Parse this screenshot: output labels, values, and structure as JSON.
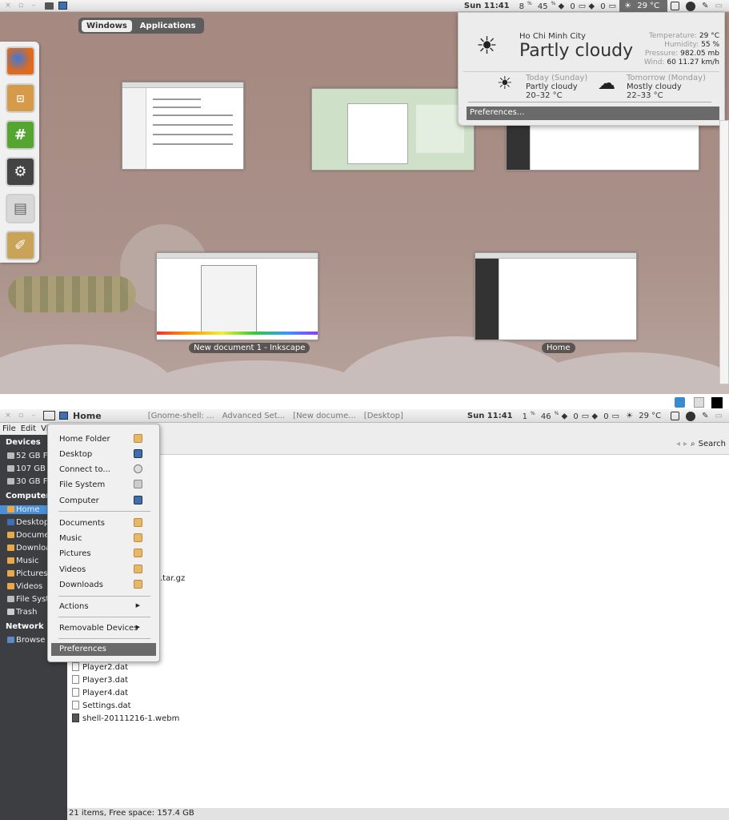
{
  "top_panel": {
    "time": "Sun 11:41",
    "cpu": "8",
    "cpu_unit": "%",
    "cpu_val": "45",
    "net1": "0",
    "net2": "0",
    "net3": "0",
    "weather_temp": "29 °C"
  },
  "overview": {
    "tabs": [
      "Windows",
      "Applications"
    ],
    "captions": [
      "New document 1 - Inkscape",
      "Home"
    ]
  },
  "dash_icons": [
    "firefox-icon",
    "archive-icon",
    "hashtag-chat-icon",
    "settings-icon",
    "drive-icon",
    "paint-icon"
  ],
  "weather": {
    "city": "Ho Chi Minh City",
    "condition": "Partly cloudy",
    "details": [
      {
        "k": "Temperature:",
        "v": "29 °C"
      },
      {
        "k": "Humidity:",
        "v": "55 %"
      },
      {
        "k": "Pressure:",
        "v": "982.05 mb"
      },
      {
        "k": "Wind:",
        "v": "60 11.27 km/h"
      }
    ],
    "today_label": "Today (Sunday)",
    "today_cond": "Partly cloudy",
    "today_temp": "20–32 °C",
    "tomorrow_label": "Tomorrow (Monday)",
    "tomorrow_cond": "Mostly cloudy",
    "tomorrow_temp": "22–33 °C",
    "preferences": "Preferences..."
  },
  "bottom_panel": {
    "app": "Home",
    "tasks": [
      "[Gnome-shell: ...",
      "Advanced Set...",
      "[New docume...",
      "[Desktop]"
    ],
    "time": "Sun 11:41",
    "cpu_val": "1",
    "cpu_unit": "%",
    "cpu_val2": "46",
    "net1": "0",
    "net2": "0",
    "net3": "0",
    "weather_temp": "29 °C"
  },
  "menubar": [
    "File",
    "Edit",
    "Vi"
  ],
  "toolbar": {
    "search": "Search"
  },
  "sidebar": {
    "devices_label": "Devices",
    "devices": [
      "52 GB Fi",
      "107 GB",
      "30 GB Fi"
    ],
    "computer_label": "Computer",
    "computer": [
      "Home",
      "Desktop",
      "Docume",
      "Downloa",
      "Music",
      "Pictures",
      "Videos",
      "File Syst",
      "Trash"
    ],
    "network_label": "Network",
    "network": [
      "Browse"
    ]
  },
  "files": {
    "partial": ".tar.gz",
    "items": [
      "Player2.dat",
      "Player3.dat",
      "Player4.dat",
      "Settings.dat",
      "shell-20111216-1.webm"
    ]
  },
  "status": "21 items, Free space: 157.4 GB",
  "places_menu": {
    "group1": [
      "Home Folder",
      "Desktop",
      "Connect to...",
      "File System",
      "Computer"
    ],
    "group2": [
      "Documents",
      "Music",
      "Pictures",
      "Videos",
      "Downloads"
    ],
    "actions": "Actions",
    "removable": "Removable Devices",
    "preferences": "Preferences"
  }
}
